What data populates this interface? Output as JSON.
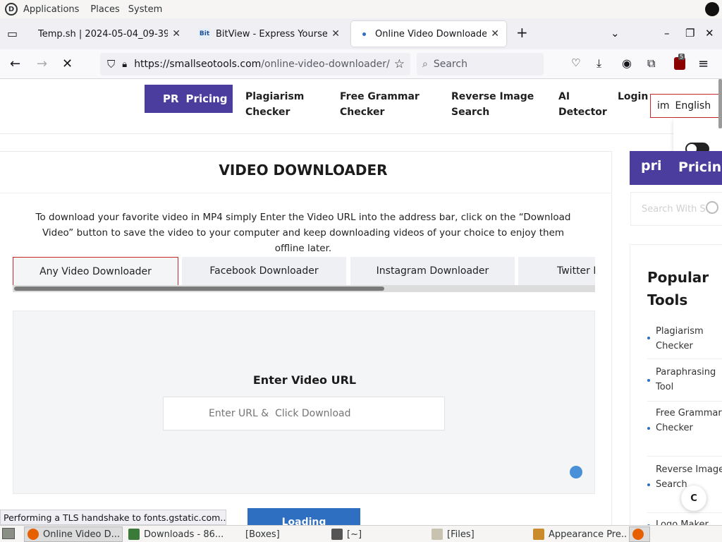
{
  "top_panel": {
    "applications": "Applications",
    "places": "Places",
    "system": "System"
  },
  "browser": {
    "tabs": [
      {
        "title": "Temp.sh | 2024-05-04_09-39-...",
        "close": "✕"
      },
      {
        "title": "BitView - Express Yourself.",
        "close": "✕",
        "favicon": "Bit"
      },
      {
        "title": "Online Video Downloader - ...",
        "close": "✕"
      }
    ],
    "new_tab": "+",
    "url_main": "https://smallseotools.com",
    "url_path": "/online-video-downloader/",
    "search_placeholder": "Search",
    "extension_badge": "5"
  },
  "site": {
    "pricing_prefix": "PR",
    "pricing_label": "Pricing",
    "menu": [
      {
        "line1": "Plagiarism",
        "line2": "Checker"
      },
      {
        "line1": "Free Grammar",
        "line2": "Checker"
      },
      {
        "line1": "Reverse Image",
        "line2": "Search"
      },
      {
        "line1": "AI",
        "line2": "Detector"
      }
    ],
    "login": "Login",
    "lang_prefix": "im",
    "lang": "English"
  },
  "main": {
    "title": "VIDEO DOWNLOADER",
    "description": "To download your favorite video in MP4 simply Enter the Video URL into the address bar, click on the “Download Video” button to save the video to your computer and keep downloading videos of your choice to enjoy them offline later.",
    "tabs": [
      "Any Video Downloader",
      "Facebook Downloader",
      "Instagram Downloader",
      "Twitter D"
    ],
    "enter_label": "Enter Video URL",
    "input_placeholder": "Enter URL &  Click Download",
    "loading": "Loading"
  },
  "sidebar": {
    "pricing_prefix": "pri",
    "pricing_label": "Pricing",
    "search_placeholder": "Search With S",
    "popular_title": "Popular Tools",
    "tools": [
      "Plagiarism Checker",
      "Paraphrasing Tool",
      "Free Grammar Checker",
      "Reverse Image Search",
      "Logo Maker"
    ],
    "scroll_top": "C"
  },
  "status": "Performing a TLS handshake to fonts.gstatic.com…",
  "taskbar": [
    {
      "label": "Online Video D..."
    },
    {
      "label": "Downloads - 86..."
    },
    {
      "label": "[Boxes]"
    },
    {
      "label": "[~]"
    },
    {
      "label": "[Files]"
    },
    {
      "label": "Appearance Pre..."
    }
  ],
  "colors": {
    "brand_purple": "#4b3d9e",
    "accent_red": "#c62828",
    "button_blue": "#2f6fc2"
  }
}
